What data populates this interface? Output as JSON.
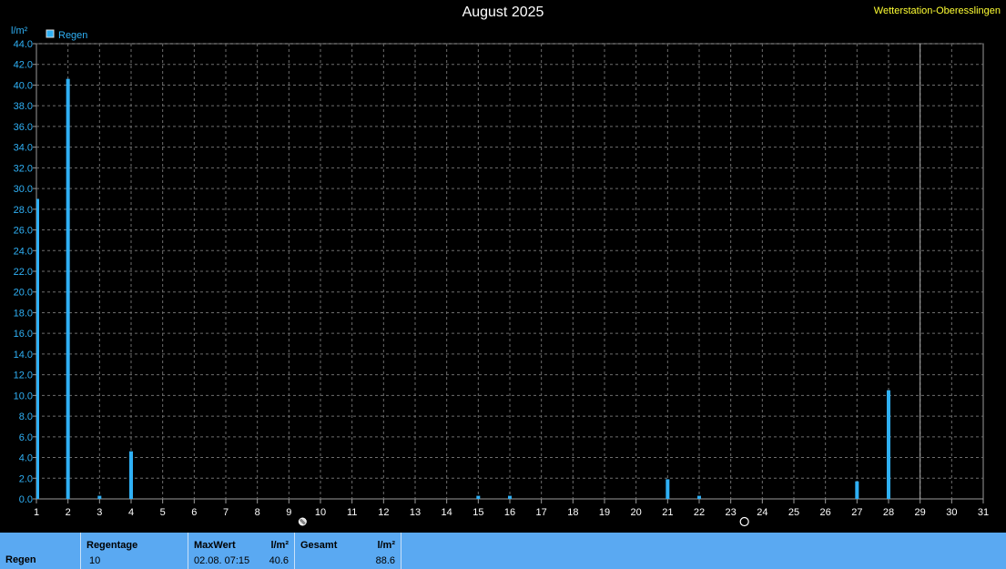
{
  "title": "August 2025",
  "station": "Wetterstation-Oberesslingen",
  "chart_data": {
    "type": "bar",
    "ylabel": "l/m²",
    "ylim": [
      0,
      44
    ],
    "yticks": [
      "0.0",
      "2.0",
      "4.0",
      "6.0",
      "8.0",
      "10.0",
      "12.0",
      "14.0",
      "16.0",
      "18.0",
      "20.0",
      "22.0",
      "24.0",
      "26.0",
      "28.0",
      "30.0",
      "32.0",
      "34.0",
      "36.0",
      "38.0",
      "40.0",
      "42.0",
      "44.0"
    ],
    "xlim": [
      1,
      31
    ],
    "xticks": [
      "1",
      "2",
      "3",
      "4",
      "5",
      "6",
      "7",
      "8",
      "9",
      "10",
      "11",
      "12",
      "13",
      "14",
      "15",
      "16",
      "17",
      "18",
      "19",
      "20",
      "21",
      "22",
      "23",
      "24",
      "25",
      "26",
      "27",
      "28",
      "29",
      "30",
      "31"
    ],
    "grid": true,
    "legend_position": "top-left",
    "series": [
      {
        "name": "Regen",
        "color": "#2fb0f5",
        "points": [
          {
            "x": 1,
            "y": 29.0
          },
          {
            "x": 2,
            "y": 40.6
          },
          {
            "x": 3,
            "y": 0.3
          },
          {
            "x": 4,
            "y": 4.6
          },
          {
            "x": 15,
            "y": 0.3
          },
          {
            "x": 16,
            "y": 0.3
          },
          {
            "x": 21,
            "y": 1.9
          },
          {
            "x": 22,
            "y": 0.3
          },
          {
            "x": 27,
            "y": 1.7
          },
          {
            "x": 28,
            "y": 10.5
          }
        ]
      }
    ],
    "moon_phases": [
      {
        "day": 9,
        "phase": "full-moon-icon"
      },
      {
        "day": 23,
        "phase": "new-moon-icon"
      }
    ],
    "current_day_marker": 29
  },
  "footer": {
    "row_label": "Regen",
    "regentage_label": "Regentage",
    "regentage_value": "10",
    "maxwert_label": "MaxWert",
    "maxwert_unit": "l/m²",
    "maxwert_time": "02.08.  07:15",
    "maxwert_value": "40.6",
    "gesamt_label": "Gesamt",
    "gesamt_unit": "l/m²",
    "gesamt_value": "88.6"
  }
}
